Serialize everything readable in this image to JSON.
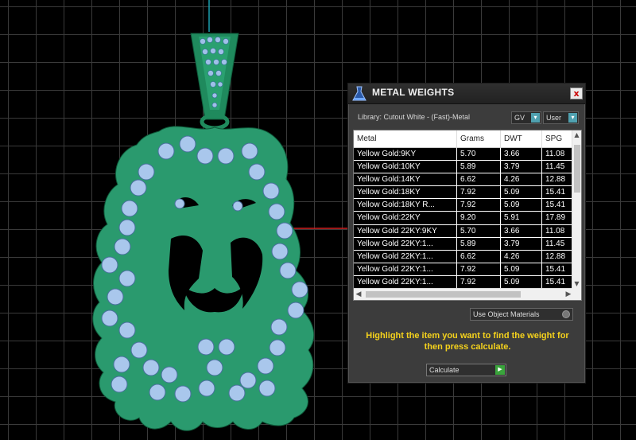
{
  "panel": {
    "title": "METAL WEIGHTS",
    "close_label": "x",
    "library_label": "Library: Cutout White - (Fast)-Metal",
    "gv_select": "GV",
    "user_select": "User",
    "columns": [
      "Metal",
      "Grams",
      "DWT",
      "SPG"
    ],
    "rows": [
      {
        "metal": "Yellow Gold:9KY",
        "grams": "5.70",
        "dwt": "3.66",
        "spg": "11.08"
      },
      {
        "metal": "Yellow Gold:10KY",
        "grams": "5.89",
        "dwt": "3.79",
        "spg": "11.45"
      },
      {
        "metal": "Yellow Gold:14KY",
        "grams": "6.62",
        "dwt": "4.26",
        "spg": "12.88"
      },
      {
        "metal": "Yellow Gold:18KY",
        "grams": "7.92",
        "dwt": "5.09",
        "spg": "15.41"
      },
      {
        "metal": "Yellow Gold:18KY R...",
        "grams": "7.92",
        "dwt": "5.09",
        "spg": "15.41"
      },
      {
        "metal": "Yellow Gold:22KY",
        "grams": "9.20",
        "dwt": "5.91",
        "spg": "17.89"
      },
      {
        "metal": "Yellow Gold 22KY:9KY",
        "grams": "5.70",
        "dwt": "3.66",
        "spg": "11.08"
      },
      {
        "metal": "Yellow Gold 22KY:1...",
        "grams": "5.89",
        "dwt": "3.79",
        "spg": "11.45"
      },
      {
        "metal": "Yellow Gold 22KY:1...",
        "grams": "6.62",
        "dwt": "4.26",
        "spg": "12.88"
      },
      {
        "metal": "Yellow Gold 22KY:1...",
        "grams": "7.92",
        "dwt": "5.09",
        "spg": "15.41"
      },
      {
        "metal": "Yellow Gold 22KY:1...",
        "grams": "7.92",
        "dwt": "5.09",
        "spg": "15.41"
      }
    ],
    "use_object_materials": "Use Object Materials",
    "hint": "Highlight the item you want to find the weight for then press calculate.",
    "calculate_label": "Calculate"
  },
  "colors": {
    "model_green": "#2a9a6e",
    "gem_blue": "#a9c7ec",
    "axis_red": "#d02020",
    "axis_cyan": "#1aa0b0",
    "hint_yellow": "#f5d21c"
  }
}
